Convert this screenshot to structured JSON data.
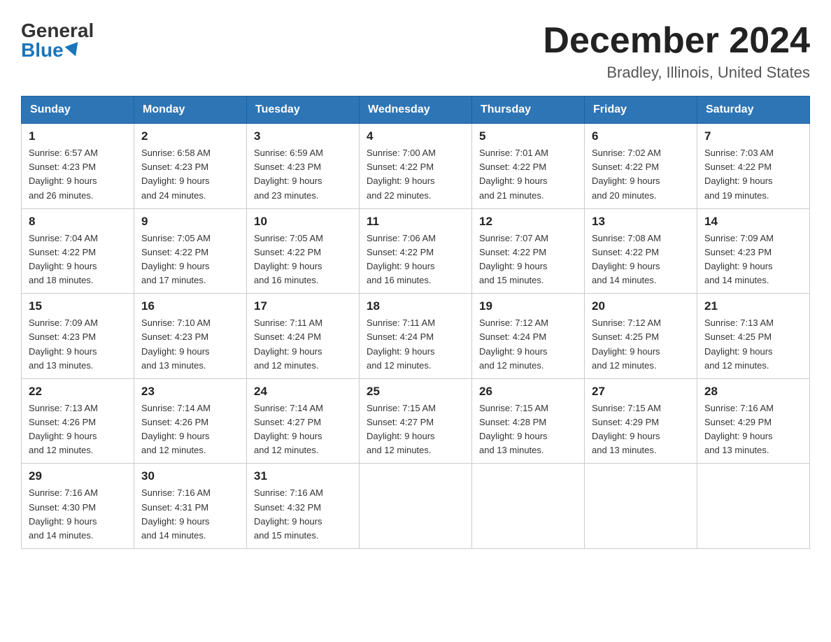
{
  "logo": {
    "general": "General",
    "blue": "Blue"
  },
  "title": "December 2024",
  "location": "Bradley, Illinois, United States",
  "weekdays": [
    "Sunday",
    "Monday",
    "Tuesday",
    "Wednesday",
    "Thursday",
    "Friday",
    "Saturday"
  ],
  "weeks": [
    [
      {
        "day": "1",
        "sunrise": "6:57 AM",
        "sunset": "4:23 PM",
        "daylight": "9 hours and 26 minutes."
      },
      {
        "day": "2",
        "sunrise": "6:58 AM",
        "sunset": "4:23 PM",
        "daylight": "9 hours and 24 minutes."
      },
      {
        "day": "3",
        "sunrise": "6:59 AM",
        "sunset": "4:23 PM",
        "daylight": "9 hours and 23 minutes."
      },
      {
        "day": "4",
        "sunrise": "7:00 AM",
        "sunset": "4:22 PM",
        "daylight": "9 hours and 22 minutes."
      },
      {
        "day": "5",
        "sunrise": "7:01 AM",
        "sunset": "4:22 PM",
        "daylight": "9 hours and 21 minutes."
      },
      {
        "day": "6",
        "sunrise": "7:02 AM",
        "sunset": "4:22 PM",
        "daylight": "9 hours and 20 minutes."
      },
      {
        "day": "7",
        "sunrise": "7:03 AM",
        "sunset": "4:22 PM",
        "daylight": "9 hours and 19 minutes."
      }
    ],
    [
      {
        "day": "8",
        "sunrise": "7:04 AM",
        "sunset": "4:22 PM",
        "daylight": "9 hours and 18 minutes."
      },
      {
        "day": "9",
        "sunrise": "7:05 AM",
        "sunset": "4:22 PM",
        "daylight": "9 hours and 17 minutes."
      },
      {
        "day": "10",
        "sunrise": "7:05 AM",
        "sunset": "4:22 PM",
        "daylight": "9 hours and 16 minutes."
      },
      {
        "day": "11",
        "sunrise": "7:06 AM",
        "sunset": "4:22 PM",
        "daylight": "9 hours and 16 minutes."
      },
      {
        "day": "12",
        "sunrise": "7:07 AM",
        "sunset": "4:22 PM",
        "daylight": "9 hours and 15 minutes."
      },
      {
        "day": "13",
        "sunrise": "7:08 AM",
        "sunset": "4:22 PM",
        "daylight": "9 hours and 14 minutes."
      },
      {
        "day": "14",
        "sunrise": "7:09 AM",
        "sunset": "4:23 PM",
        "daylight": "9 hours and 14 minutes."
      }
    ],
    [
      {
        "day": "15",
        "sunrise": "7:09 AM",
        "sunset": "4:23 PM",
        "daylight": "9 hours and 13 minutes."
      },
      {
        "day": "16",
        "sunrise": "7:10 AM",
        "sunset": "4:23 PM",
        "daylight": "9 hours and 13 minutes."
      },
      {
        "day": "17",
        "sunrise": "7:11 AM",
        "sunset": "4:24 PM",
        "daylight": "9 hours and 12 minutes."
      },
      {
        "day": "18",
        "sunrise": "7:11 AM",
        "sunset": "4:24 PM",
        "daylight": "9 hours and 12 minutes."
      },
      {
        "day": "19",
        "sunrise": "7:12 AM",
        "sunset": "4:24 PM",
        "daylight": "9 hours and 12 minutes."
      },
      {
        "day": "20",
        "sunrise": "7:12 AM",
        "sunset": "4:25 PM",
        "daylight": "9 hours and 12 minutes."
      },
      {
        "day": "21",
        "sunrise": "7:13 AM",
        "sunset": "4:25 PM",
        "daylight": "9 hours and 12 minutes."
      }
    ],
    [
      {
        "day": "22",
        "sunrise": "7:13 AM",
        "sunset": "4:26 PM",
        "daylight": "9 hours and 12 minutes."
      },
      {
        "day": "23",
        "sunrise": "7:14 AM",
        "sunset": "4:26 PM",
        "daylight": "9 hours and 12 minutes."
      },
      {
        "day": "24",
        "sunrise": "7:14 AM",
        "sunset": "4:27 PM",
        "daylight": "9 hours and 12 minutes."
      },
      {
        "day": "25",
        "sunrise": "7:15 AM",
        "sunset": "4:27 PM",
        "daylight": "9 hours and 12 minutes."
      },
      {
        "day": "26",
        "sunrise": "7:15 AM",
        "sunset": "4:28 PM",
        "daylight": "9 hours and 13 minutes."
      },
      {
        "day": "27",
        "sunrise": "7:15 AM",
        "sunset": "4:29 PM",
        "daylight": "9 hours and 13 minutes."
      },
      {
        "day": "28",
        "sunrise": "7:16 AM",
        "sunset": "4:29 PM",
        "daylight": "9 hours and 13 minutes."
      }
    ],
    [
      {
        "day": "29",
        "sunrise": "7:16 AM",
        "sunset": "4:30 PM",
        "daylight": "9 hours and 14 minutes."
      },
      {
        "day": "30",
        "sunrise": "7:16 AM",
        "sunset": "4:31 PM",
        "daylight": "9 hours and 14 minutes."
      },
      {
        "day": "31",
        "sunrise": "7:16 AM",
        "sunset": "4:32 PM",
        "daylight": "9 hours and 15 minutes."
      },
      null,
      null,
      null,
      null
    ]
  ],
  "labels": {
    "sunrise": "Sunrise:",
    "sunset": "Sunset:",
    "daylight": "Daylight: 9 hours"
  },
  "colors": {
    "header_bg": "#2e75b6",
    "header_text": "#ffffff",
    "border": "#aaaaaa"
  }
}
